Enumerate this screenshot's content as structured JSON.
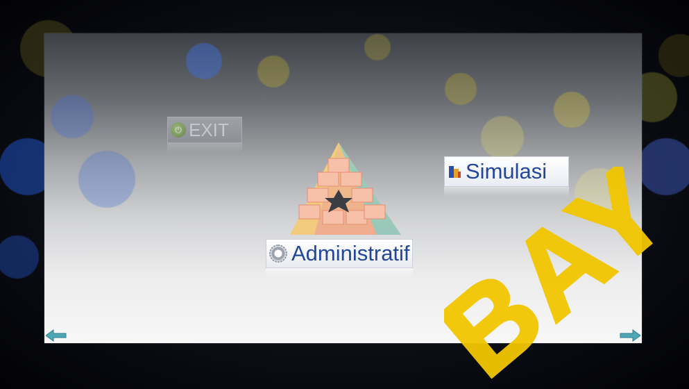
{
  "buttons": {
    "exit_label": "EXIT",
    "simulasi_label": "Simulasi",
    "administratif_label": "Administratif"
  },
  "icons": {
    "exit": "power-icon",
    "simulasi": "chart-icon",
    "administratif": "gear-icon",
    "logo": "impossible-pyramid-logo",
    "prev": "arrow-left-icon",
    "next": "arrow-right-icon"
  },
  "watermark": {
    "text": "BAY"
  },
  "colors": {
    "label_blue": "#22469b",
    "watermark_yellow": "#f2c600",
    "arrow_teal": "#4fa6b4"
  }
}
